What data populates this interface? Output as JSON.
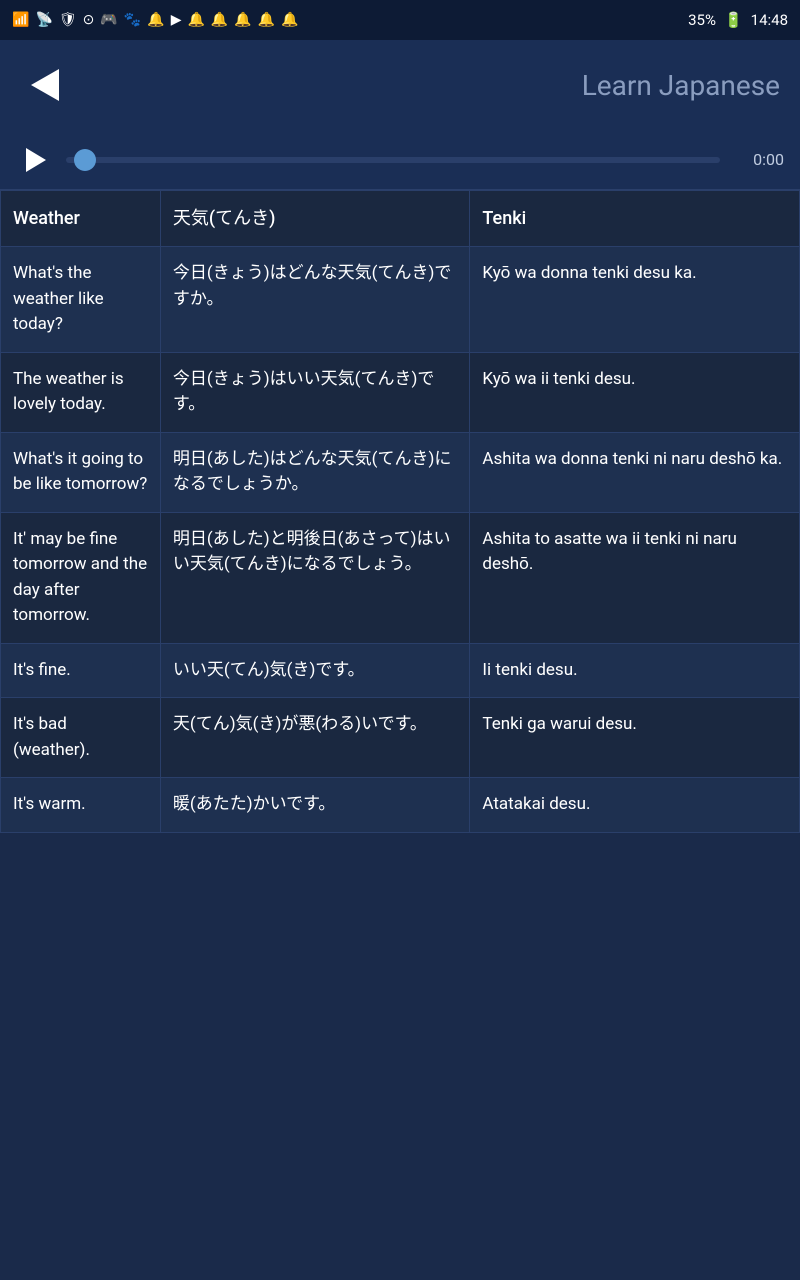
{
  "statusBar": {
    "batteryPercent": "35%",
    "time": "14:48"
  },
  "appBar": {
    "backLabel": "back",
    "title": "Learn Japanese"
  },
  "player": {
    "time": "0:00"
  },
  "table": {
    "headers": [
      "Weather",
      "天気(てんき)",
      "Tenki"
    ],
    "rows": [
      {
        "english": "What's the weather like today?",
        "japanese": "今日(きょう)はどんな天気(てんき)ですか。",
        "romaji": "Kyō wa donna tenki desu ka."
      },
      {
        "english": "The weather is lovely today.",
        "japanese": "今日(きょう)はいい天気(てんき)です。",
        "romaji": "Kyō wa ii tenki desu."
      },
      {
        "english": "What's it going to be like tomorrow?",
        "japanese": "明日(あした)はどんな天気(てんき)になるでしょうか。",
        "romaji": "Ashita wa donna tenki ni naru deshō ka."
      },
      {
        "english": "It' may be fine tomorrow and the day after tomorrow.",
        "japanese": "明日(あした)と明後日(あさって)はいい天気(てんき)になるでしょう。",
        "romaji": "Ashita to asatte wa ii tenki ni naru deshō."
      },
      {
        "english": "It's fine.",
        "japanese": "いい天(てん)気(き)です。",
        "romaji": "Ii tenki desu."
      },
      {
        "english": "It's bad (weather).",
        "japanese": "天(てん)気(き)が悪(わる)いです。",
        "romaji": "Tenki ga warui desu."
      },
      {
        "english": "It's warm.",
        "japanese": "暖(あたた)かいです。",
        "romaji": "Atatakai desu."
      }
    ]
  }
}
